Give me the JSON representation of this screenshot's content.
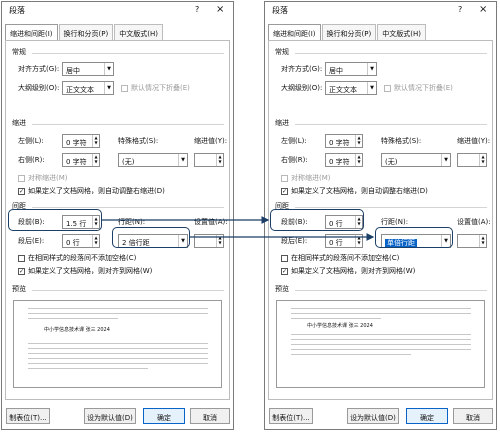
{
  "dialogs": [
    {
      "title": "段落",
      "help": "?",
      "close": "×",
      "tabs": [
        "缩进和间距(I)",
        "换行和分页(P)",
        "中文版式(H)"
      ],
      "general": {
        "heading": "常规",
        "alignment_label": "对齐方式(G):",
        "alignment_value": "居中",
        "outline_label": "大纲级别(O):",
        "outline_value": "正文文本",
        "collapse_label": "默认情况下折叠(E)"
      },
      "indent": {
        "heading": "缩进",
        "left_label": "左侧(L):",
        "left_value": "0 字符",
        "right_label": "右侧(R):",
        "right_value": "0 字符",
        "special_label": "特殊格式(S):",
        "special_value": "(无)",
        "indent_by_label": "缩进值(Y):",
        "mirror_label": "对称缩进(M)",
        "auto_adjust_label": "如果定义了文档网格，则自动调整右缩进(D)"
      },
      "spacing": {
        "heading": "间距",
        "before_label": "段前(B):",
        "before_value": "1.5 行",
        "after_label": "段后(E):",
        "after_value": "0 行",
        "line_label": "行距(N):",
        "line_value": "2 倍行距",
        "at_label": "设置值(A):",
        "no_space_label": "在相同样式的段落间不添加空格(C)",
        "snap_label": "如果定义了文档网格，则对齐到网格(W)"
      },
      "preview": {
        "heading": "预览",
        "sample_text": "中小学信息技术课     张三     2024"
      },
      "buttons": {
        "tabs": "制表位(T)...",
        "default": "设为默认值(D)",
        "ok": "确定",
        "cancel": "取消"
      }
    },
    {
      "title": "段落",
      "help": "?",
      "close": "×",
      "tabs": [
        "缩进和间距(I)",
        "换行和分页(P)",
        "中文版式(H)"
      ],
      "general": {
        "heading": "常规",
        "alignment_label": "对齐方式(G):",
        "alignment_value": "居中",
        "outline_label": "大纲级别(O):",
        "outline_value": "正文文本",
        "collapse_label": "默认情况下折叠(E)"
      },
      "indent": {
        "heading": "缩进",
        "left_label": "左侧(L):",
        "left_value": "0 字符",
        "right_label": "右侧(R):",
        "right_value": "0 字符",
        "special_label": "特殊格式(S):",
        "special_value": "(无)",
        "indent_by_label": "缩进值(Y):",
        "mirror_label": "对称缩进(M)",
        "auto_adjust_label": "如果定义了文档网格，则自动调整右缩进(D)"
      },
      "spacing": {
        "heading": "间距",
        "before_label": "段前(B):",
        "before_value": "0 行",
        "after_label": "段后(E):",
        "after_value": "0 行",
        "line_label": "行距(N):",
        "line_value": "单倍行距",
        "at_label": "设置值(A):",
        "no_space_label": "在相同样式的段落间不添加空格(C)",
        "snap_label": "如果定义了文档网格，则对齐到网格(W)"
      },
      "preview": {
        "heading": "预览",
        "sample_text": "中小学信息技术课     张三     2024"
      },
      "buttons": {
        "tabs": "制表位(T)...",
        "default": "设为默认值(D)",
        "ok": "确定",
        "cancel": "取消"
      }
    }
  ],
  "colors": {
    "callout": "#1b3f66",
    "selection": "#0a64c8"
  }
}
